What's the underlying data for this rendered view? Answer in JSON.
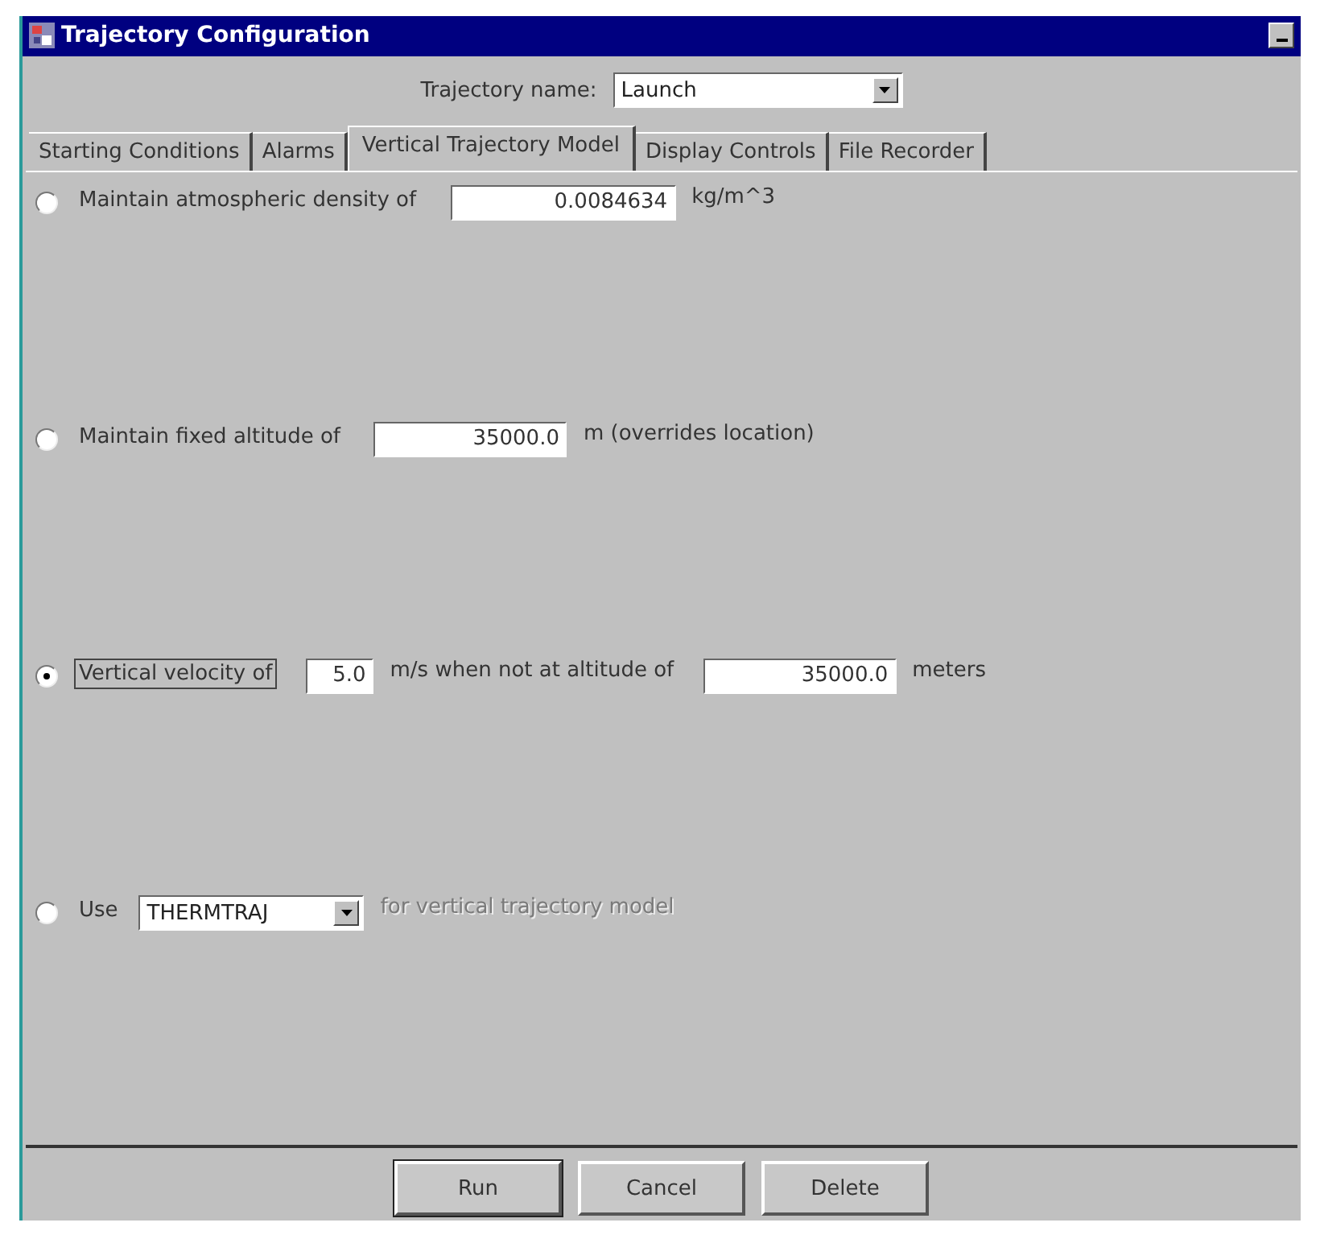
{
  "window": {
    "title": "Trajectory Configuration"
  },
  "trajectory_name": {
    "label": "Trajectory name:",
    "value": "Launch"
  },
  "tabs": [
    {
      "label": "Starting Conditions",
      "selected": false
    },
    {
      "label": "Alarms",
      "selected": false
    },
    {
      "label": "Vertical Trajectory Model",
      "selected": true
    },
    {
      "label": "Display Controls",
      "selected": false
    },
    {
      "label": "File Recorder",
      "selected": false
    }
  ],
  "options": [
    {
      "label": "Maintain atmospheric density of",
      "selected": false,
      "focused": false,
      "parts": [
        {
          "kind": "field",
          "value": "0.0084634"
        },
        {
          "kind": "text",
          "text": "kg/m^3",
          "disabled": false
        }
      ]
    },
    {
      "label": "Maintain fixed altitude of",
      "selected": false,
      "focused": false,
      "parts": [
        {
          "kind": "field",
          "value": "35000.0"
        },
        {
          "kind": "text",
          "text": "m (overrides location)",
          "disabled": false
        }
      ]
    },
    {
      "label": "Vertical velocity of",
      "selected": true,
      "focused": true,
      "parts": [
        {
          "kind": "field",
          "value": "5.0"
        },
        {
          "kind": "text",
          "text": "m/s when not at altitude of",
          "disabled": false
        },
        {
          "kind": "field",
          "value": "35000.0"
        },
        {
          "kind": "text",
          "text": "meters",
          "disabled": false
        }
      ]
    },
    {
      "label": "Use",
      "selected": false,
      "focused": false,
      "parts": [
        {
          "kind": "combo",
          "value": "THERMTRAJ"
        },
        {
          "kind": "text",
          "text": "for vertical trajectory model",
          "disabled": true
        }
      ]
    }
  ],
  "buttons": [
    "Run",
    "Cancel",
    "Delete"
  ]
}
